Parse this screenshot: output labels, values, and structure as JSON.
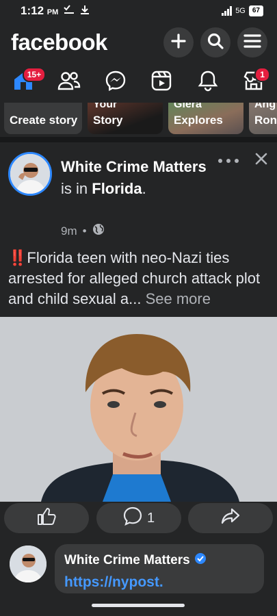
{
  "status_bar": {
    "time": "1:12",
    "ampm": "PM",
    "network": "5G",
    "battery": "67"
  },
  "header": {
    "logo": "facebook",
    "buttons": [
      {
        "icon": "plus-icon"
      },
      {
        "icon": "search-icon"
      },
      {
        "icon": "menu-icon"
      }
    ]
  },
  "nav": {
    "items": [
      {
        "icon": "home-icon",
        "badge": "15+"
      },
      {
        "icon": "friends-icon",
        "badge": ""
      },
      {
        "icon": "messenger-icon",
        "badge": ""
      },
      {
        "icon": "video-icon",
        "badge": ""
      },
      {
        "icon": "bell-icon",
        "badge": ""
      },
      {
        "icon": "marketplace-icon",
        "badge": "1"
      }
    ]
  },
  "stories": [
    {
      "label": "Create story"
    },
    {
      "label": "Story",
      "top_text": "Your"
    },
    {
      "label": "Explores",
      "top_text": "Giera"
    },
    {
      "label": "Ron",
      "top_text": "Ang"
    }
  ],
  "post": {
    "author": "White Crime Matters",
    "is_in": "is in",
    "location": "Florida",
    "period": ".",
    "time": "9m",
    "dot": "•",
    "audience_icon": "globe-icon",
    "text_emoji": "‼️",
    "text": "Florida teen with neo-Nazi ties arrested for alleged church attack plot and child sexual a...",
    "see_more": "See more",
    "image_alt": "mugshot photo of teenage boy"
  },
  "actions": {
    "like_icon": "thumbs-up-icon",
    "comment_icon": "comment-icon",
    "comment_count": "1",
    "share_icon": "share-icon"
  },
  "comment": {
    "author": "White Crime Matters",
    "verified_icon": "verified-icon",
    "link": "https://nypost."
  },
  "colors": {
    "background": "#242526",
    "surface": "#3a3b3c",
    "accent_blue": "#2d88ff",
    "badge_red": "#e41e3f",
    "link_blue": "#4599ff"
  }
}
